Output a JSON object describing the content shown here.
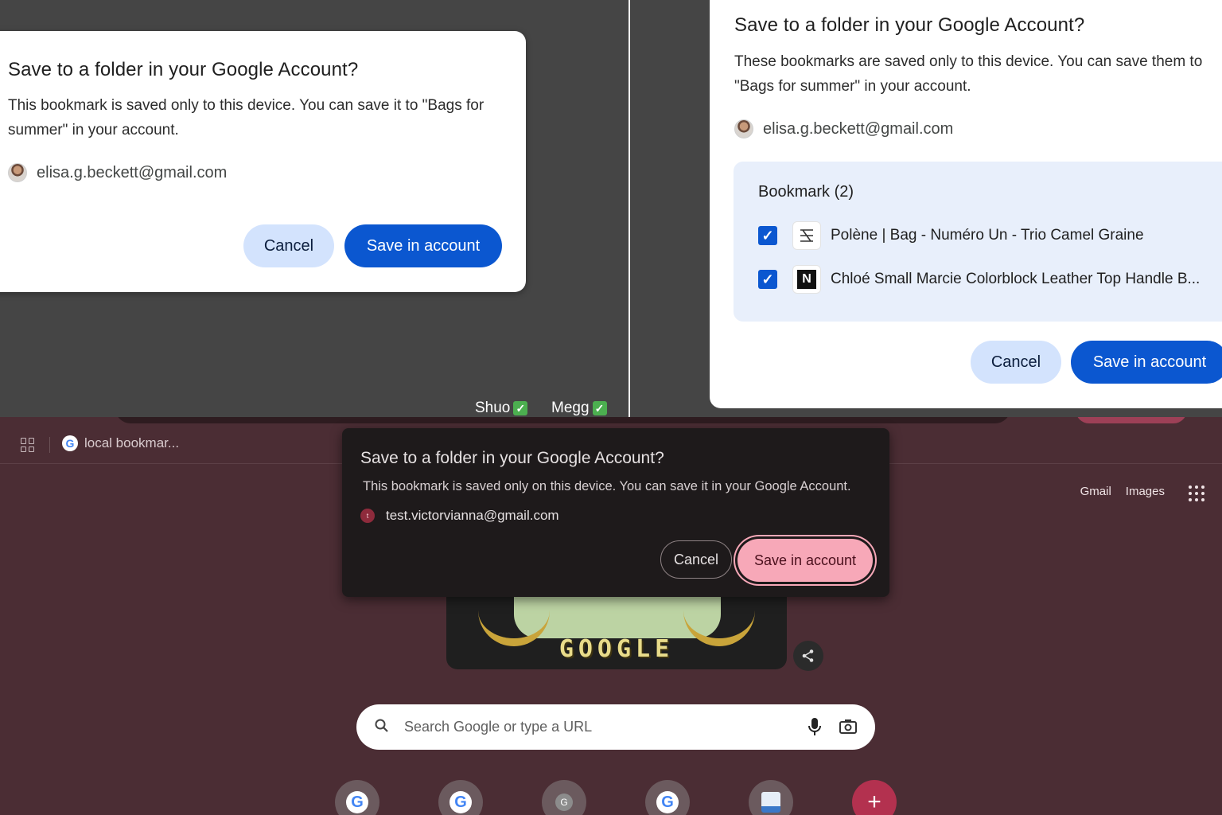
{
  "dialog_single": {
    "title": "Save to a folder in your Google Account?",
    "body": "This bookmark is saved only to this device. You can save it to \"Bags for summer\" in your account.",
    "account_email": "elisa.g.beckett@gmail.com",
    "cancel_label": "Cancel",
    "save_label": "Save in account"
  },
  "reviewers": [
    {
      "name": "Shuo",
      "mark": "✓"
    },
    {
      "name": "Megg",
      "mark": "✓"
    }
  ],
  "dialog_multi": {
    "title": "Save to a folder in your Google Account?",
    "body": "These bookmarks are saved only to this device. You can save them to \"Bags for summer\" in your account.",
    "account_email": "elisa.g.beckett@gmail.com",
    "list_header": "Bookmark (2)",
    "items": [
      {
        "title": "Polène | Bag - Numéro Un - Trio Camel Graine",
        "checked": true,
        "favicon": "polene-logo-icon"
      },
      {
        "title": "Chloé Small Marcie Colorblock Leather Top Handle B...",
        "checked": true,
        "favicon": "n-logo-icon"
      }
    ],
    "cancel_label": "Cancel",
    "save_label": "Save in account"
  },
  "browser": {
    "bookmark_bar_item": "local bookmar...",
    "top_links": [
      "Gmail",
      "Images"
    ],
    "doodle_text": "GOOGLE",
    "search_placeholder": "Search Google or type a URL",
    "shortcuts": [
      "G",
      "G",
      "G",
      "G",
      "doc",
      "+"
    ]
  },
  "dialog_dark": {
    "title": "Save to a folder in your Google Account?",
    "body": "This bookmark is saved only on this device. You can save it in your Google Account.",
    "account_email": "test.victorvianna@gmail.com",
    "avatar_letter": "t",
    "cancel_label": "Cancel",
    "save_label": "Save in account"
  },
  "colors": {
    "primary_blue": "#0b57d0",
    "tonal_blue": "#d3e3fd",
    "dark_accent_pink": "#f7a8b8",
    "browser_bg": "#4b2d34"
  }
}
